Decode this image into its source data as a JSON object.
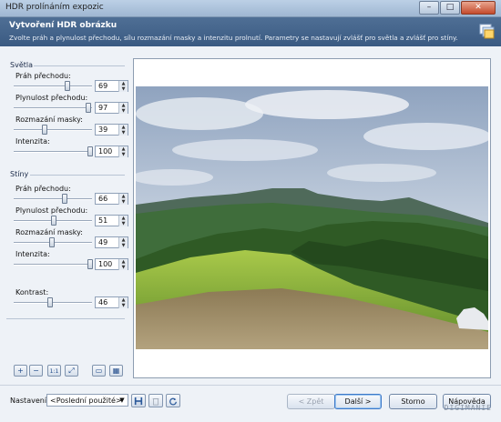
{
  "window": {
    "title": "HDR prolínáním expozic",
    "controls": {
      "minimize": "–",
      "maximize": "□",
      "close": "✕"
    }
  },
  "header": {
    "title": "Vytvoření HDR obrázku",
    "subtitle": "Zvolte práh a plynulost přechodu, sílu rozmazání masky a intenzitu prolnutí. Parametry se nastavují zvlášť pro světla a zvlášť pro stíny.",
    "icon": "hdr-stack-icon"
  },
  "lights": {
    "title": "Světla",
    "params": [
      {
        "label": "Práh přechodu:",
        "value": "69",
        "level": 0.69
      },
      {
        "label": "Plynulost přechodu:",
        "value": "97",
        "level": 0.97
      },
      {
        "label": "Rozmazání masky:",
        "value": "39",
        "level": 0.39
      },
      {
        "label": "Intenzita:",
        "value": "100",
        "level": 1.0
      }
    ]
  },
  "shadows": {
    "title": "Stíny",
    "params": [
      {
        "label": "Práh přechodu:",
        "value": "66",
        "level": 0.66
      },
      {
        "label": "Plynulost přechodu:",
        "value": "51",
        "level": 0.51
      },
      {
        "label": "Rozmazání masky:",
        "value": "49",
        "level": 0.49
      },
      {
        "label": "Intenzita:",
        "value": "100",
        "level": 1.0
      }
    ]
  },
  "contrast": {
    "label": "Kontrast:",
    "value": "46",
    "level": 0.46
  },
  "zoom_tools": [
    {
      "icon": "zoom-in-icon",
      "glyph": "+"
    },
    {
      "icon": "zoom-out-icon",
      "glyph": "−"
    },
    {
      "icon": "zoom-actual-icon",
      "glyph": "1:1"
    },
    {
      "icon": "zoom-fit-icon",
      "glyph": "⤢"
    },
    {
      "icon": "show-original-icon",
      "glyph": "▭"
    },
    {
      "icon": "show-mask-icon",
      "glyph": "▦"
    }
  ],
  "footer": {
    "settings_label": "Nastavení:",
    "preset": "<Poslední použité>",
    "save_icon": "save-icon",
    "delete_icon": "delete-icon",
    "reset_icon": "reset-icon",
    "back": "< Zpět",
    "next": "Další >",
    "cancel": "Storno",
    "help": "Nápověda"
  },
  "watermark": "DIGIMANIE"
}
